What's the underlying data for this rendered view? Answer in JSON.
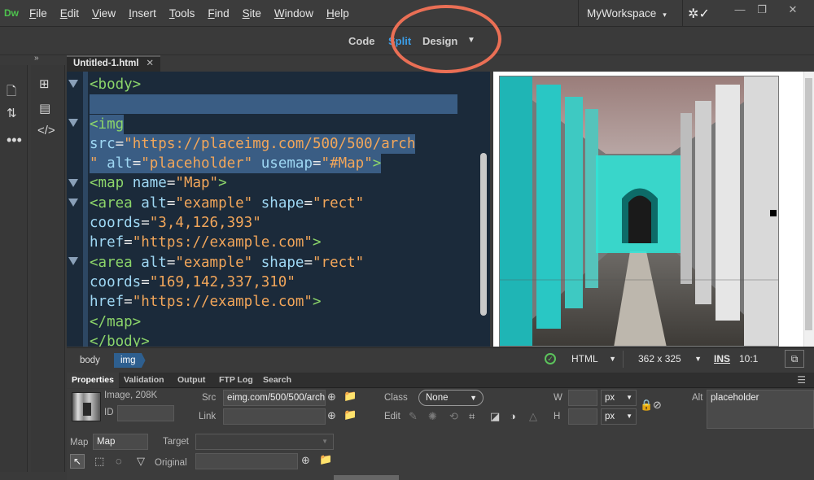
{
  "app": {
    "logo": "Dw"
  },
  "menu": [
    {
      "label": "File",
      "u": "F",
      "rest": "ile"
    },
    {
      "label": "Edit",
      "u": "E",
      "rest": "dit"
    },
    {
      "label": "View",
      "u": "V",
      "rest": "iew"
    },
    {
      "label": "Insert",
      "u": "I",
      "rest": "nsert"
    },
    {
      "label": "Tools",
      "u": "T",
      "rest": "ools"
    },
    {
      "label": "Find",
      "u": "F",
      "rest": "ind"
    },
    {
      "label": "Site",
      "u": "S",
      "rest": "ite"
    },
    {
      "label": "Window",
      "u": "W",
      "rest": "indow"
    },
    {
      "label": "Help",
      "u": "H",
      "rest": "elp"
    }
  ],
  "workspace": {
    "label": "MyWorkspace"
  },
  "view_switch": {
    "code": "Code",
    "split": "Split",
    "design": "Design",
    "active": "split"
  },
  "document": {
    "tab_label": "Untitled-1.html"
  },
  "code_lines": [
    [
      {
        "t": "tg",
        "v": "<body>"
      }
    ],
    [],
    [
      {
        "t": "tg",
        "v": "<img"
      }
    ],
    [
      {
        "t": "at",
        "v": "src"
      },
      {
        "t": "pl",
        "v": "="
      },
      {
        "t": "st",
        "v": "\"https://placeimg.com/500/500/arch"
      }
    ],
    [
      {
        "t": "st",
        "v": "\""
      },
      {
        "t": "pl",
        "v": " "
      },
      {
        "t": "at",
        "v": "alt"
      },
      {
        "t": "pl",
        "v": "="
      },
      {
        "t": "st",
        "v": "\"placeholder\""
      },
      {
        "t": "pl",
        "v": " "
      },
      {
        "t": "at",
        "v": "usemap"
      },
      {
        "t": "pl",
        "v": "="
      },
      {
        "t": "st",
        "v": "\"#Map\""
      },
      {
        "t": "tg",
        "v": ">"
      }
    ],
    [
      {
        "t": "tg",
        "v": "<map"
      },
      {
        "t": "pl",
        "v": " "
      },
      {
        "t": "at",
        "v": "name"
      },
      {
        "t": "pl",
        "v": "="
      },
      {
        "t": "st",
        "v": "\"Map\""
      },
      {
        "t": "tg",
        "v": ">"
      }
    ],
    [
      {
        "t": "tg",
        "v": "<area"
      },
      {
        "t": "pl",
        "v": " "
      },
      {
        "t": "at",
        "v": "alt"
      },
      {
        "t": "pl",
        "v": "="
      },
      {
        "t": "st",
        "v": "\"example\""
      },
      {
        "t": "pl",
        "v": " "
      },
      {
        "t": "at",
        "v": "shape"
      },
      {
        "t": "pl",
        "v": "="
      },
      {
        "t": "st",
        "v": "\"rect\""
      }
    ],
    [
      {
        "t": "at",
        "v": "coords"
      },
      {
        "t": "pl",
        "v": "="
      },
      {
        "t": "st",
        "v": "\"3,4,126,393\""
      }
    ],
    [
      {
        "t": "at",
        "v": "href"
      },
      {
        "t": "pl",
        "v": "="
      },
      {
        "t": "st",
        "v": "\"https://example.com\""
      },
      {
        "t": "tg",
        "v": ">"
      }
    ],
    [
      {
        "t": "tg",
        "v": "<area"
      },
      {
        "t": "pl",
        "v": " "
      },
      {
        "t": "at",
        "v": "alt"
      },
      {
        "t": "pl",
        "v": "="
      },
      {
        "t": "st",
        "v": "\"example\""
      },
      {
        "t": "pl",
        "v": " "
      },
      {
        "t": "at",
        "v": "shape"
      },
      {
        "t": "pl",
        "v": "="
      },
      {
        "t": "st",
        "v": "\"rect\""
      }
    ],
    [
      {
        "t": "at",
        "v": "coords"
      },
      {
        "t": "pl",
        "v": "="
      },
      {
        "t": "st",
        "v": "\"169,142,337,310\""
      }
    ],
    [
      {
        "t": "at",
        "v": "href"
      },
      {
        "t": "pl",
        "v": "="
      },
      {
        "t": "st",
        "v": "\"https://example.com\""
      },
      {
        "t": "tg",
        "v": ">"
      }
    ],
    [
      {
        "t": "tg",
        "v": "</map>"
      }
    ],
    [
      {
        "t": "tg",
        "v": "</body>"
      }
    ]
  ],
  "selected_code_lines": [
    2,
    3,
    4
  ],
  "status_bar": {
    "crumbs": [
      "body",
      "img"
    ],
    "language": "HTML",
    "dimensions": "362 x 325",
    "insert_mode": "INS",
    "cursor_pos": "10:1"
  },
  "properties": {
    "tabs": [
      "Properties",
      "Validation",
      "Output",
      "FTP Log",
      "Search"
    ],
    "active_tab": "Properties",
    "element_info": "Image, 208K",
    "id_label": "ID",
    "id_value": "",
    "src_label": "Src",
    "src_value": "eimg.com/500/500/arch",
    "link_label": "Link",
    "link_value": "",
    "class_label": "Class",
    "class_value": "None",
    "edit_label": "Edit",
    "w_label": "W",
    "h_label": "H",
    "unit_w": "px",
    "unit_h": "px",
    "alt_label": "Alt",
    "alt_value": "placeholder",
    "map_label": "Map",
    "map_value": "Map",
    "target_label": "Target",
    "original_label": "Original"
  },
  "icons": {
    "left_bar": [
      "files-icon",
      "sort-icon",
      "more-icon"
    ],
    "left_bar2": [
      "dom-tree-icon",
      "assets-icon",
      "code-snippet-icon"
    ]
  },
  "colors": {
    "split_active": "#3b9ee8",
    "code_bg": "#1b2a3a",
    "selection": "#3a5d84",
    "tag": "#8cd56a",
    "attr": "#9fd8f4",
    "string": "#f2a65a",
    "annotation": "#ea6f55",
    "image_map_highlight": "#2ee6d8"
  }
}
